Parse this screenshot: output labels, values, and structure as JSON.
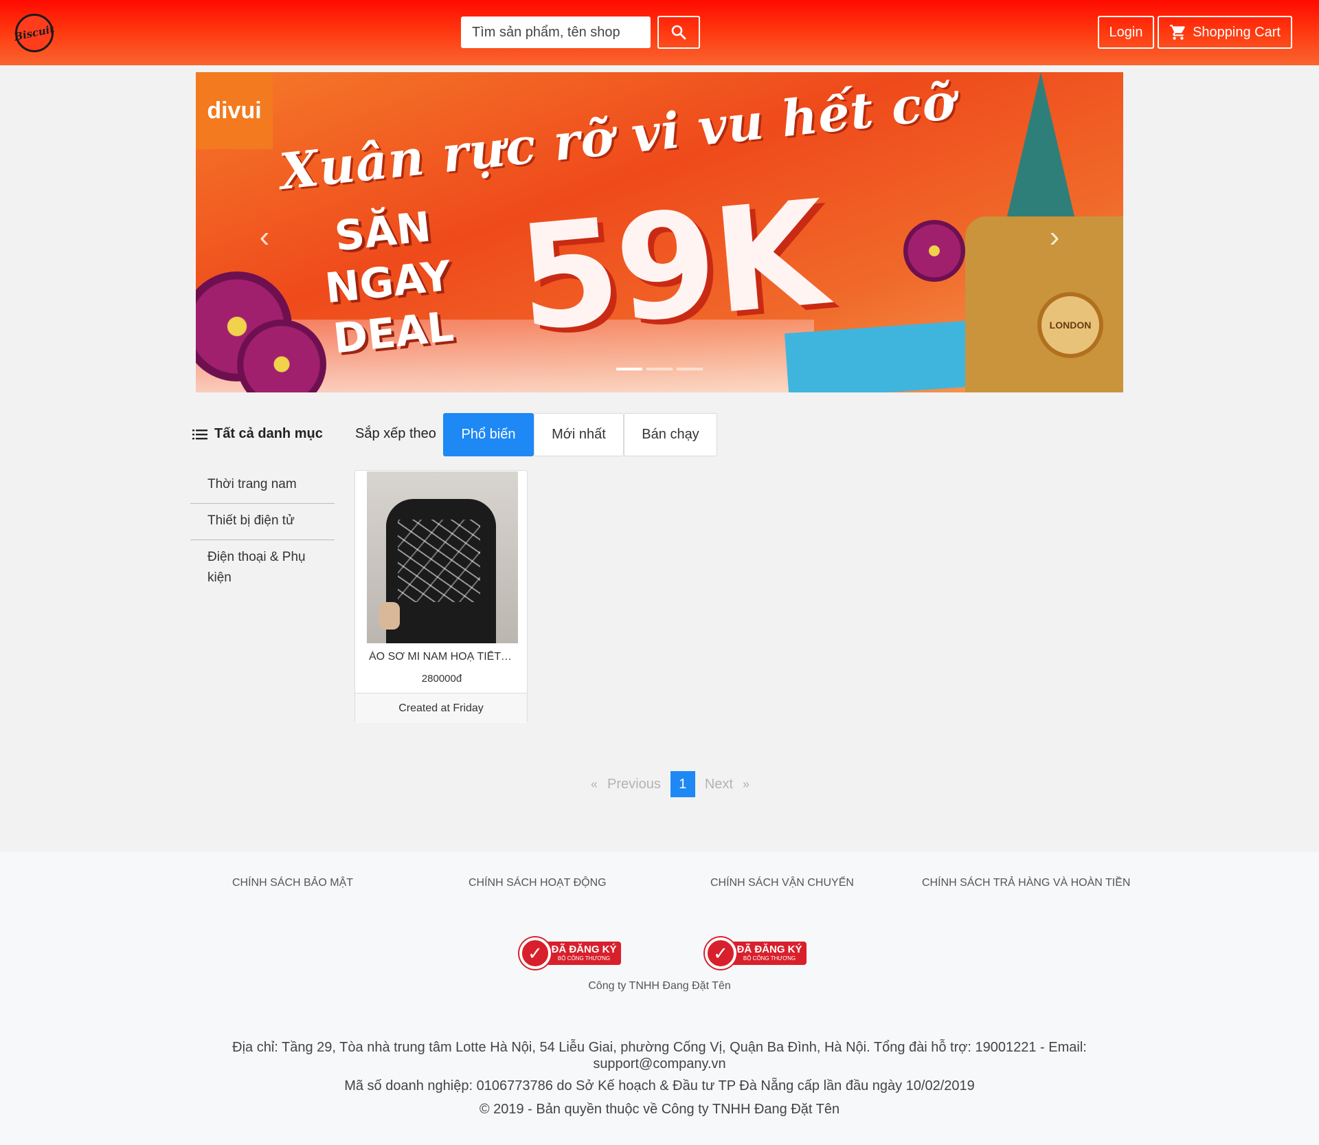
{
  "header": {
    "logo_text": "Biscuit",
    "search_placeholder": "Tìm sản phẩm, tên shop",
    "login_label": "Login",
    "cart_label": "Shopping Cart",
    "icons": [
      "search-icon",
      "cart-icon"
    ]
  },
  "banner": {
    "brand": "divui",
    "headline": "Xuân rực rỡ vi vu hết cỡ",
    "cta": "SĂN NGAY DEAL",
    "price": "59K",
    "badge": "LONDON",
    "slide_count": 3,
    "active_slide": 1
  },
  "sidebar": {
    "title": "Tất cả danh mục",
    "items": [
      {
        "label": "Thời trang nam"
      },
      {
        "label": "Thiết bị điện tử"
      },
      {
        "label": "Điện thoại & Phụ kiện"
      }
    ]
  },
  "sort": {
    "label": "Sắp xếp theo",
    "options": [
      {
        "label": "Phổ biến",
        "active": true
      },
      {
        "label": "Mới nhất",
        "active": false
      },
      {
        "label": "Bán chạy",
        "active": false
      }
    ]
  },
  "products": [
    {
      "name": "ÁO SƠ MI NAM HOẠ TIẾT CÔNG THỨC",
      "price": "280000đ",
      "created": "Created at Friday"
    }
  ],
  "pagination": {
    "prev_symbol": "«",
    "prev_label": "Previous",
    "current": "1",
    "next_label": "Next",
    "next_symbol": "»"
  },
  "footer": {
    "policies": [
      "CHÍNH SÁCH BẢO MẬT",
      "CHÍNH SÁCH HOẠT ĐỘNG",
      "CHÍNH SÁCH VẬN CHUYỂN",
      "CHÍNH SÁCH TRẢ HÀNG VÀ HOÀN TIỀN"
    ],
    "registered_badge": {
      "title": "ĐÃ ĐĂNG KÝ",
      "subtitle": "BỘ CÔNG THƯƠNG"
    },
    "company_name": "Công ty TNHH Đang Đặt Tên",
    "address": "Địa chỉ: Tầng 29, Tòa nhà trung tâm Lotte Hà Nội, 54 Liễu Giai, phường Cống Vị, Quận Ba Đình, Hà Nội. Tổng đài hỗ trợ: 19001221 - Email: support@company.vn",
    "business_code": "Mã số doanh nghiệp: 0106773786 do Sở Kế hoạch & Đầu tư TP Đà Nẵng cấp lần đầu ngày 10/02/2019",
    "copyright": "© 2019 - Bản quyền thuộc về Công ty TNHH Đang Đặt Tên"
  },
  "colors": {
    "header_start": "#ff0a00",
    "header_end": "#f9652f",
    "accent_blue": "#1e88f5",
    "page_bg": "#f2f2f2",
    "footer_bg": "#f7f8fa"
  }
}
